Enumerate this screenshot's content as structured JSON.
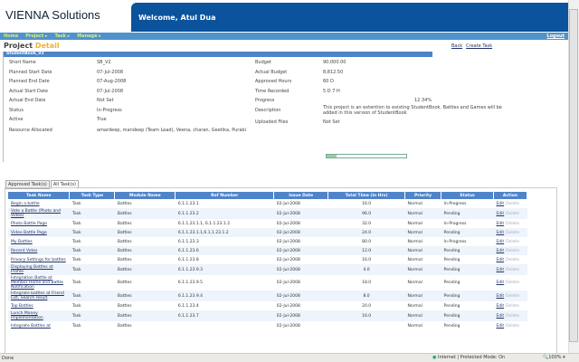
{
  "header": {
    "logo": "VIENNA Solutions",
    "welcome": "Welcome, Atul Dua"
  },
  "nav": {
    "items": [
      "Home",
      "Project ▸",
      "Task ▸",
      "Manage ▸"
    ],
    "logout": "Logout"
  },
  "page": {
    "title_a": "Project",
    "title_b": "Detail",
    "back": "Back",
    "create_task": "Create Task"
  },
  "project": {
    "name": "StudentBook_V2",
    "left": [
      [
        "Short Name",
        "SB_V2"
      ],
      [
        "Planned Start Date",
        "07-Jul-2008"
      ],
      [
        "Planned End Date",
        "07-Aug-2008"
      ],
      [
        "Actual Start Date",
        "07-Jul-2008"
      ],
      [
        "Actual End Date",
        "Not Set"
      ],
      [
        "Status",
        "In-Progress"
      ],
      [
        "Active",
        "True"
      ],
      [
        "Resource Allocated",
        "amardeep, mandeep (Team Lead), Veena, charan, Geetika, Purabi"
      ]
    ],
    "right": [
      [
        "Budget",
        "90,000.00"
      ],
      [
        "Actual Budget",
        "8,812.50"
      ],
      [
        "Approved Hours",
        "60 D"
      ],
      [
        "Time Recorded",
        "5 D 7 H"
      ],
      [
        "Progress",
        "12.34%"
      ],
      [
        "Description",
        "This project is an extention to existing StudentBook. Battles and Games will be added in this version of StudentBook"
      ],
      [
        "Uploaded Files",
        "Not Set"
      ]
    ],
    "progress_fraction": 0.1234
  },
  "tabs": [
    "Approved Task(s)",
    "All Task(s)"
  ],
  "table": {
    "headers": [
      "Task Name",
      "Task Type",
      "Module Name",
      "Ref Number",
      "Issue Date",
      "Total Time (in Hrs)",
      "Priority",
      "Status",
      "Action"
    ],
    "edit": "Edit",
    "delete": "Delete",
    "rows": [
      [
        "Begin a battle",
        "Task",
        "Battles",
        "6.1.1.23.1",
        "02-Jul-2008",
        "16.0",
        "Normal",
        "In-Progress"
      ],
      [
        "Vote a Battle (Photo and Video)",
        "Task",
        "Battles",
        "6.1.1.23.2",
        "02-Jul-2008",
        "96.0",
        "Normal",
        "Pending"
      ],
      [
        "Photo Battle Page",
        "Task",
        "Battles",
        "6.1.1.23.1.1, 6.1.1.23.1.2",
        "02-Jul-2008",
        "32.0",
        "Normal",
        "In-Progress"
      ],
      [
        "Video Battle Page",
        "Task",
        "Battles",
        "6.1.1.23.1.1,6.1.1.23.1.2",
        "02-Jul-2008",
        "24.0",
        "Normal",
        "Pending"
      ],
      [
        "My Battles",
        "Task",
        "Battles",
        "6.1.1.23.3",
        "02-Jul-2008",
        "80.0",
        "Normal",
        "In-Progress"
      ],
      [
        "Recent Votes",
        "Task",
        "Battles",
        "6.1.1.23.6",
        "02-Jul-2008",
        "12.0",
        "Normal",
        "Pending"
      ],
      [
        "Privacy Settings for battles",
        "Task",
        "Battles",
        "6.1.1.23.8",
        "02-Jul-2008",
        "16.0",
        "Normal",
        "Pending"
      ],
      [
        "Displaying Battles at Profile",
        "Task",
        "Battles",
        "6.1.1.23.9.3",
        "02-Jul-2008",
        "4.0",
        "Normal",
        "Pending"
      ],
      [
        "Integration Battle at Member Home and Battle Notification",
        "Task",
        "Battles",
        "6.1.1.23.9.5",
        "02-Jul-2008",
        "18.0",
        "Normal",
        "Pending"
      ],
      [
        "Integrate battles at Friend List, Search result",
        "Task",
        "Battles",
        "6.1.1.23.9.4",
        "02-Jul-2008",
        "8.0",
        "Normal",
        "Pending"
      ],
      [
        "Top Battles",
        "Task",
        "Battles",
        "6.1.1.23.4",
        "02-Jul-2008",
        "20.0",
        "Normal",
        "Pending"
      ],
      [
        "Lunch Money Implementation",
        "Task",
        "Battles",
        "6.1.1.23.7",
        "02-Jul-2008",
        "16.0",
        "Normal",
        "Pending"
      ],
      [
        "Integrate Battles at",
        "Task",
        "Battles",
        "",
        "02-Jul-2008",
        "",
        "Normal",
        "Pending"
      ]
    ]
  },
  "status": {
    "left": "Done",
    "zone": "Internet | Protected Mode: On",
    "zoom": "100%"
  }
}
